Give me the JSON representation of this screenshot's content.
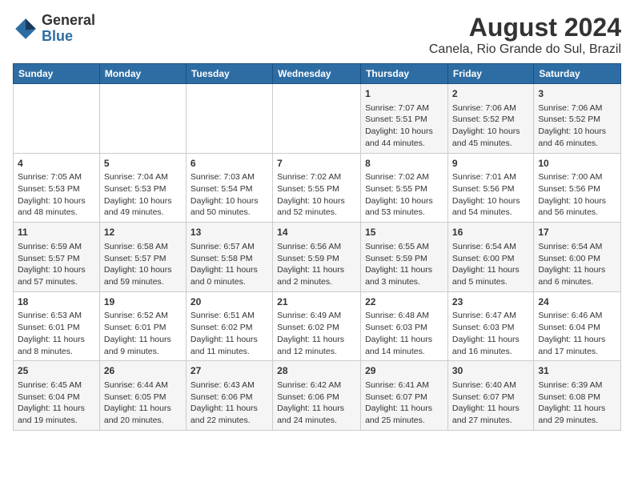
{
  "logo": {
    "text_general": "General",
    "text_blue": "Blue"
  },
  "title": "August 2024",
  "subtitle": "Canela, Rio Grande do Sul, Brazil",
  "days_of_week": [
    "Sunday",
    "Monday",
    "Tuesday",
    "Wednesday",
    "Thursday",
    "Friday",
    "Saturday"
  ],
  "weeks": [
    [
      {
        "day": "",
        "info": ""
      },
      {
        "day": "",
        "info": ""
      },
      {
        "day": "",
        "info": ""
      },
      {
        "day": "",
        "info": ""
      },
      {
        "day": "1",
        "info": "Sunrise: 7:07 AM\nSunset: 5:51 PM\nDaylight: 10 hours\nand 44 minutes."
      },
      {
        "day": "2",
        "info": "Sunrise: 7:06 AM\nSunset: 5:52 PM\nDaylight: 10 hours\nand 45 minutes."
      },
      {
        "day": "3",
        "info": "Sunrise: 7:06 AM\nSunset: 5:52 PM\nDaylight: 10 hours\nand 46 minutes."
      }
    ],
    [
      {
        "day": "4",
        "info": "Sunrise: 7:05 AM\nSunset: 5:53 PM\nDaylight: 10 hours\nand 48 minutes."
      },
      {
        "day": "5",
        "info": "Sunrise: 7:04 AM\nSunset: 5:53 PM\nDaylight: 10 hours\nand 49 minutes."
      },
      {
        "day": "6",
        "info": "Sunrise: 7:03 AM\nSunset: 5:54 PM\nDaylight: 10 hours\nand 50 minutes."
      },
      {
        "day": "7",
        "info": "Sunrise: 7:02 AM\nSunset: 5:55 PM\nDaylight: 10 hours\nand 52 minutes."
      },
      {
        "day": "8",
        "info": "Sunrise: 7:02 AM\nSunset: 5:55 PM\nDaylight: 10 hours\nand 53 minutes."
      },
      {
        "day": "9",
        "info": "Sunrise: 7:01 AM\nSunset: 5:56 PM\nDaylight: 10 hours\nand 54 minutes."
      },
      {
        "day": "10",
        "info": "Sunrise: 7:00 AM\nSunset: 5:56 PM\nDaylight: 10 hours\nand 56 minutes."
      }
    ],
    [
      {
        "day": "11",
        "info": "Sunrise: 6:59 AM\nSunset: 5:57 PM\nDaylight: 10 hours\nand 57 minutes."
      },
      {
        "day": "12",
        "info": "Sunrise: 6:58 AM\nSunset: 5:57 PM\nDaylight: 10 hours\nand 59 minutes."
      },
      {
        "day": "13",
        "info": "Sunrise: 6:57 AM\nSunset: 5:58 PM\nDaylight: 11 hours\nand 0 minutes."
      },
      {
        "day": "14",
        "info": "Sunrise: 6:56 AM\nSunset: 5:59 PM\nDaylight: 11 hours\nand 2 minutes."
      },
      {
        "day": "15",
        "info": "Sunrise: 6:55 AM\nSunset: 5:59 PM\nDaylight: 11 hours\nand 3 minutes."
      },
      {
        "day": "16",
        "info": "Sunrise: 6:54 AM\nSunset: 6:00 PM\nDaylight: 11 hours\nand 5 minutes."
      },
      {
        "day": "17",
        "info": "Sunrise: 6:54 AM\nSunset: 6:00 PM\nDaylight: 11 hours\nand 6 minutes."
      }
    ],
    [
      {
        "day": "18",
        "info": "Sunrise: 6:53 AM\nSunset: 6:01 PM\nDaylight: 11 hours\nand 8 minutes."
      },
      {
        "day": "19",
        "info": "Sunrise: 6:52 AM\nSunset: 6:01 PM\nDaylight: 11 hours\nand 9 minutes."
      },
      {
        "day": "20",
        "info": "Sunrise: 6:51 AM\nSunset: 6:02 PM\nDaylight: 11 hours\nand 11 minutes."
      },
      {
        "day": "21",
        "info": "Sunrise: 6:49 AM\nSunset: 6:02 PM\nDaylight: 11 hours\nand 12 minutes."
      },
      {
        "day": "22",
        "info": "Sunrise: 6:48 AM\nSunset: 6:03 PM\nDaylight: 11 hours\nand 14 minutes."
      },
      {
        "day": "23",
        "info": "Sunrise: 6:47 AM\nSunset: 6:03 PM\nDaylight: 11 hours\nand 16 minutes."
      },
      {
        "day": "24",
        "info": "Sunrise: 6:46 AM\nSunset: 6:04 PM\nDaylight: 11 hours\nand 17 minutes."
      }
    ],
    [
      {
        "day": "25",
        "info": "Sunrise: 6:45 AM\nSunset: 6:04 PM\nDaylight: 11 hours\nand 19 minutes."
      },
      {
        "day": "26",
        "info": "Sunrise: 6:44 AM\nSunset: 6:05 PM\nDaylight: 11 hours\nand 20 minutes."
      },
      {
        "day": "27",
        "info": "Sunrise: 6:43 AM\nSunset: 6:06 PM\nDaylight: 11 hours\nand 22 minutes."
      },
      {
        "day": "28",
        "info": "Sunrise: 6:42 AM\nSunset: 6:06 PM\nDaylight: 11 hours\nand 24 minutes."
      },
      {
        "day": "29",
        "info": "Sunrise: 6:41 AM\nSunset: 6:07 PM\nDaylight: 11 hours\nand 25 minutes."
      },
      {
        "day": "30",
        "info": "Sunrise: 6:40 AM\nSunset: 6:07 PM\nDaylight: 11 hours\nand 27 minutes."
      },
      {
        "day": "31",
        "info": "Sunrise: 6:39 AM\nSunset: 6:08 PM\nDaylight: 11 hours\nand 29 minutes."
      }
    ]
  ]
}
